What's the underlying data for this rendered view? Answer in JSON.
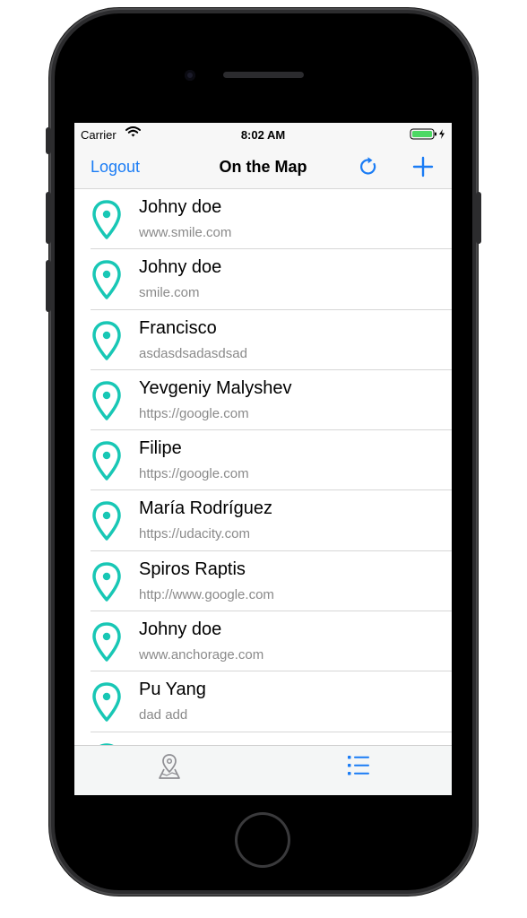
{
  "status_bar": {
    "carrier": "Carrier",
    "time": "8:02 AM"
  },
  "nav": {
    "left_button": "Logout",
    "title": "On the Map",
    "refresh_icon": "refresh-icon",
    "add_icon": "plus-icon"
  },
  "students": [
    {
      "name": "Johny doe",
      "url": "www.smile.com"
    },
    {
      "name": "Johny doe",
      "url": "smile.com"
    },
    {
      "name": "Francisco",
      "url": "asdasdsadasdsad"
    },
    {
      "name": "Yevgeniy Malyshev",
      "url": "https://google.com"
    },
    {
      "name": "Filipe",
      "url": "https://google.com"
    },
    {
      "name": "María Rodríguez",
      "url": "https://udacity.com"
    },
    {
      "name": "Spiros Raptis",
      "url": "http://www.google.com"
    },
    {
      "name": "Johny doe",
      "url": "www.anchorage.com"
    },
    {
      "name": "Pu Yang",
      "url": "dad add"
    }
  ],
  "tabs": [
    {
      "icon": "map-pin-icon",
      "selected": false
    },
    {
      "icon": "list-icon",
      "selected": true
    }
  ],
  "colors": {
    "accent": "#1a7cf5",
    "pin": "#18c7b5",
    "tab_inactive": "#8e8e93"
  }
}
